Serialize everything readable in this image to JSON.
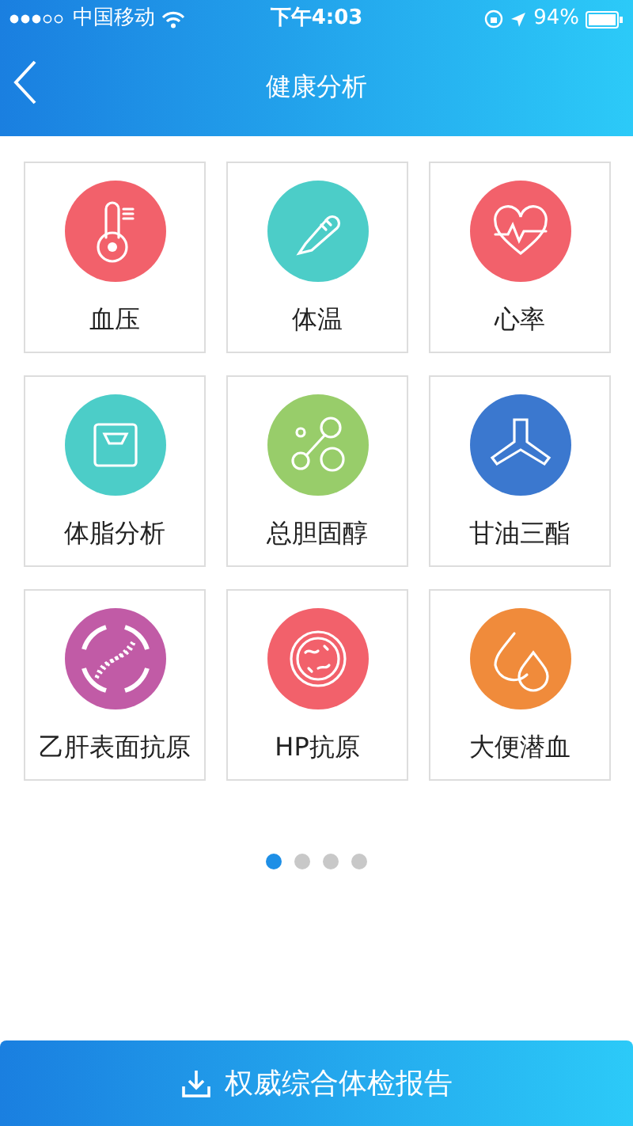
{
  "status_bar": {
    "carrier": "中国移动",
    "time": "下午4:03",
    "battery": "94%"
  },
  "header": {
    "title": "健康分析"
  },
  "tiles": [
    {
      "label": "血压",
      "color": "#f2616b"
    },
    {
      "label": "体温",
      "color": "#4ccdc8"
    },
    {
      "label": "心率",
      "color": "#f2616b"
    },
    {
      "label": "体脂分析",
      "color": "#4ccdc8"
    },
    {
      "label": "总胆固醇",
      "color": "#98cd6a"
    },
    {
      "label": "甘油三酯",
      "color": "#3b78cf"
    },
    {
      "label": "乙肝表面抗原",
      "color": "#c15ba6"
    },
    {
      "label": "HP抗原",
      "color": "#f2616b"
    },
    {
      "label": "大便潜血",
      "color": "#f08b3b"
    }
  ],
  "pager": [
    {
      "selected": true
    },
    {
      "selected": false
    },
    {
      "selected": false
    },
    {
      "selected": false
    }
  ],
  "report_button": {
    "label": "权威综合体检报告"
  }
}
